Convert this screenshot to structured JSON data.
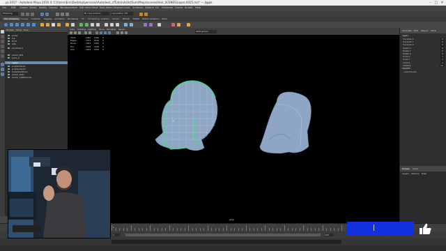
{
  "window": {
    "title": "...ya 2017 - Autodesk Maya 2016 4: C:\\Users\\Eric\\Desktop\\personal\\Autodesk_cfTutorials\\ActSum\\Maya\\scenes\\Hair_SCENES\\Lapse.0025.ma* --- Jiggle",
    "controls": [
      "–",
      "□",
      "✕"
    ]
  },
  "menus": [
    "File",
    "Edit",
    "Create",
    "Select",
    "Modify",
    "Display",
    "Windows",
    "Mesh",
    "Edit Mesh",
    "Mesh Tools",
    "Mesh Display",
    "Curves",
    "Surfaces",
    "Deform",
    "UV",
    "Generate",
    "Cache",
    "Arnold",
    "Help"
  ],
  "shelf_tabs": [
    "Poly Modeling",
    "Curves",
    "Surfaces",
    "Rigging",
    "Animation",
    "Rendering",
    "FX",
    "FX Caching",
    "Custom",
    "Arnold",
    "Bifrost",
    "MASH",
    "Motion Graphics",
    "XGen"
  ],
  "statusline": {
    "workspace": "Modeling",
    "no_live": "No Live Surface",
    "symmetry": "Symmetry: Off"
  },
  "viewport_menu": [
    "View",
    "Shading",
    "Lighting",
    "Show",
    "Renderer",
    "Panels"
  ],
  "colorspace": "sRGB gamma",
  "outliner": {
    "menu": [
      "Display",
      "Show",
      "Help"
    ],
    "items": [
      {
        "label": "persp",
        "selected": false
      },
      {
        "label": "top",
        "selected": false
      },
      {
        "label": "front",
        "selected": false
      },
      {
        "label": "side",
        "selected": false
      },
      {
        "label": "pCylinder1",
        "selected": false
      },
      {
        "label": "pairs1_BIG",
        "selected": false
      },
      {
        "label": "pairs_b",
        "selected": false
      },
      {
        "label": "cape1",
        "selected": true
      },
      {
        "label": "polySurface1",
        "selected": false
      },
      {
        "label": "polySurface2",
        "selected": false
      },
      {
        "label": "hairsMainPlane",
        "selected": false
      },
      {
        "label": "pairs1_BIG1",
        "selected": false
      },
      {
        "label": "pairs1_1000pieces",
        "selected": false
      }
    ]
  },
  "hud": {
    "rows": [
      {
        "name": "Verts:",
        "a": "1092",
        "b": "1092",
        "c": "0"
      },
      {
        "name": "Edges:",
        "a": "2142",
        "b": "2142",
        "c": "0"
      },
      {
        "name": "Faces:",
        "a": "1054",
        "b": "1054",
        "c": "0"
      },
      {
        "name": "Tris:",
        "a": "2108",
        "b": "2108",
        "c": "0"
      },
      {
        "name": "UVs:",
        "a": "1164",
        "b": "1164",
        "c": "0"
      }
    ]
  },
  "camera_label": "persp",
  "channel_box": {
    "tabs": [
      "Channels",
      "Edit",
      "Object",
      "Show"
    ],
    "object": "cape1",
    "attributes": [
      {
        "label": "Translate X",
        "value": "0"
      },
      {
        "label": "Translate Y",
        "value": "0"
      },
      {
        "label": "Translate Z",
        "value": "0"
      },
      {
        "label": "Rotate X",
        "value": "0"
      },
      {
        "label": "Rotate Y",
        "value": "0"
      },
      {
        "label": "Rotate Z",
        "value": "0"
      },
      {
        "label": "Scale X",
        "value": "1"
      },
      {
        "label": "Scale Y",
        "value": "1"
      },
      {
        "label": "Scale Z",
        "value": "1"
      },
      {
        "label": "Visibility",
        "value": "on"
      }
    ],
    "shapes_label": "SHAPES",
    "shape_name": "cape1Shape"
  },
  "layers": {
    "tabs": [
      "Display",
      "Anim"
    ],
    "menu": [
      "Layers",
      "Options",
      "Help"
    ]
  },
  "timeline": {
    "start": "1",
    "end": "120",
    "current": "1",
    "no_char_set": "No Character Set",
    "anim_layer": "No Anim Layer"
  },
  "colors": {
    "selection_green": "#3ddc84",
    "mesh_blue": "#8ea6c4",
    "banner_blue": "#1230e0",
    "selected_row": "#6a8cb0"
  },
  "icons": {
    "thumb": "thumbs-up-icon",
    "cursor": "text-cursor-icon"
  }
}
